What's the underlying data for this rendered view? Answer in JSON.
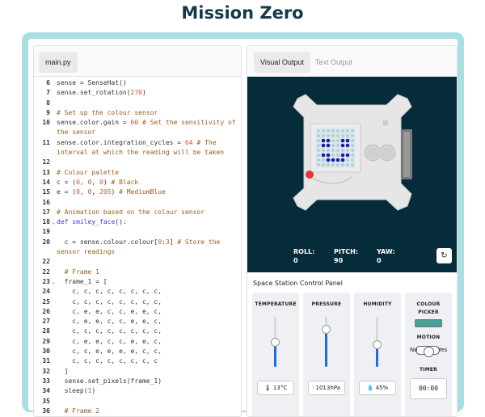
{
  "page_title": "Mission Zero",
  "editor": {
    "file_tab": "main.py",
    "lines": [
      {
        "n": "6",
        "h": "sense = SenseHat()"
      },
      {
        "n": "7",
        "h": "sense.set_rotation(<span class='nm'>270</span>)"
      },
      {
        "n": "8",
        "h": ""
      },
      {
        "n": "9",
        "h": "<span class='cm'># Set up the colour sensor</span>"
      },
      {
        "n": "10",
        "h": "sense.color.gain = <span class='nm'>60</span> <span class='cm'># Set the sensitivity of the sensor</span>",
        "tall": true
      },
      {
        "n": "11",
        "h": "sense.color.integration_cycles = <span class='nm'>64</span> <span class='cm'># The interval at which the reading will be taken</span>",
        "tall": true
      },
      {
        "n": "12",
        "h": ""
      },
      {
        "n": "13",
        "h": "<span class='cm'># Colour palette</span>"
      },
      {
        "n": "14",
        "h": "c = (<span class='nm'>0</span>, <span class='nm'>0</span>, <span class='nm'>0</span>) <span class='cm'># Black</span>"
      },
      {
        "n": "15",
        "h": "e = (<span class='nm'>0</span>, <span class='nm'>0</span>, <span class='nm'>205</span>) <span class='cm'># MediumBlue</span>"
      },
      {
        "n": "16",
        "h": ""
      },
      {
        "n": "17",
        "h": "<span class='cm'># Animation based on the colour sensor</span>"
      },
      {
        "n": "18",
        "f": "v",
        "h": "<span class='kw'>def</span> <span class='kw'>smiley_face</span>():"
      },
      {
        "n": "19",
        "h": ""
      },
      {
        "n": "20",
        "h": "  c = sense.colour.colour[<span class='nm'>0</span>:<span class='nm'>3</span>] <span class='cm'># Store the sensor readings</span>",
        "tall": true
      },
      {
        "n": "22",
        "h": ""
      },
      {
        "n": "22",
        "h": "  <span class='cm'># Frame 1</span>"
      },
      {
        "n": "23",
        "f": "v",
        "h": "  frame_1 = ["
      },
      {
        "n": "24",
        "h": "    c, c, c, c, c, c, c, c,"
      },
      {
        "n": "25",
        "h": "    c, c, c, c, c, c, c, c,"
      },
      {
        "n": "26",
        "h": "    c, e, e, c, c, e, e, c,"
      },
      {
        "n": "27",
        "h": "    c, e, e, c, c, e, e, c,"
      },
      {
        "n": "28",
        "h": "    c, c, c, c, c, c, c, c,"
      },
      {
        "n": "29",
        "h": "    c, e, e, c, c, e, e, c,"
      },
      {
        "n": "30",
        "h": "    c, c, e, e, e, e, c, c,"
      },
      {
        "n": "31",
        "h": "    c, c, c, c, c, c, c, c"
      },
      {
        "n": "32",
        "h": "  ]"
      },
      {
        "n": "33",
        "h": "  sense.set_pixels(frame_1)"
      },
      {
        "n": "34",
        "h": "  sleep(<span class='nm'>1</span>)"
      },
      {
        "n": "35",
        "h": ""
      },
      {
        "n": "36",
        "h": "  <span class='cm'># Frame 2</span>"
      }
    ]
  },
  "output": {
    "tabs": [
      "Visual Output",
      "Text Output"
    ],
    "active_tab": "Visual Output",
    "telemetry": [
      {
        "label": "ROLL:",
        "value": "0"
      },
      {
        "label": "PITCH:",
        "value": "90"
      },
      {
        "label": "YAW:",
        "value": "0"
      }
    ],
    "refresh_icon": "refresh-icon"
  },
  "panel": {
    "title": "Space Station Control Panel",
    "temperature": {
      "label": "TEMPERATURE",
      "level": 0.5,
      "reading": "13°C",
      "icon": "thermometer-icon"
    },
    "pressure": {
      "label": "PRESSURE",
      "level": 0.76,
      "reading": "1013hPa",
      "icon": "pressure-icon"
    },
    "humidity": {
      "label": "HUMIDITY",
      "level": 0.45,
      "reading": "45%",
      "icon": "droplet-icon"
    },
    "colour": {
      "label": "COLOUR",
      "sub": "PICKER",
      "swatch": "#4aa198"
    },
    "motion": {
      "label": "MOTION",
      "off": "No",
      "on": "Yes"
    },
    "timer": {
      "label": "TIMER",
      "value": "00:00"
    }
  }
}
